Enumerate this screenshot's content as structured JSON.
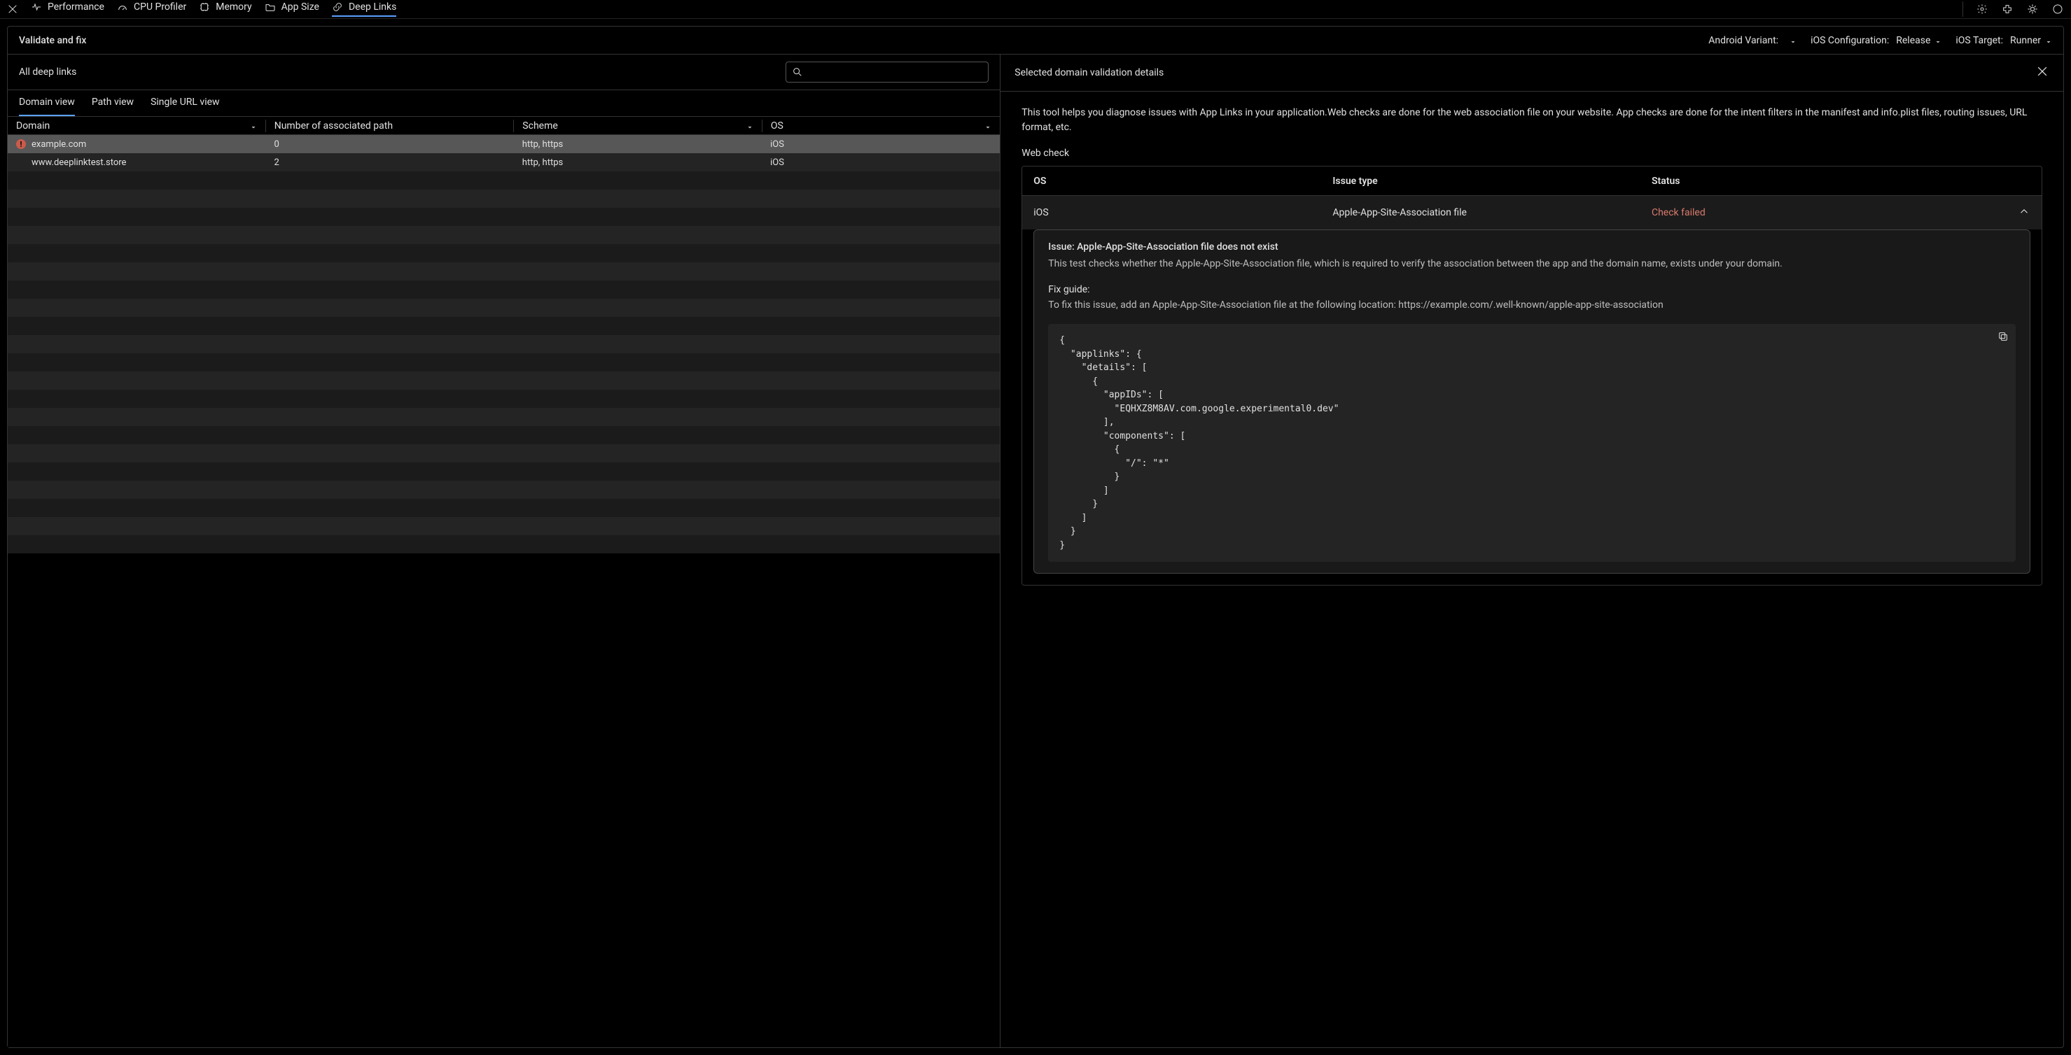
{
  "nav": {
    "tabs": [
      {
        "label": "Performance",
        "icon": "pulse-icon"
      },
      {
        "label": "CPU Profiler",
        "icon": "gauge-icon"
      },
      {
        "label": "Memory",
        "icon": "layers-icon"
      },
      {
        "label": "App Size",
        "icon": "folder-icon"
      },
      {
        "label": "Deep Links",
        "icon": "link-icon",
        "active": true
      }
    ]
  },
  "configBar": {
    "title": "Validate and fix",
    "androidVariantLabel": "Android Variant:",
    "androidVariantValue": "",
    "iosConfigLabel": "iOS Configuration:",
    "iosConfigValue": "Release",
    "iosTargetLabel": "iOS Target:",
    "iosTargetValue": "Runner"
  },
  "leftPane": {
    "header": "All deep links",
    "searchPlaceholder": "",
    "tabs": {
      "domain": "Domain view",
      "path": "Path view",
      "single": "Single URL view"
    },
    "tableHeaders": {
      "domain": "Domain",
      "paths": "Number of associated path",
      "scheme": "Scheme",
      "os": "OS"
    },
    "rows": [
      {
        "status": "error",
        "domain": "example.com",
        "paths": "0",
        "scheme": "http, https",
        "os": "iOS",
        "selected": true
      },
      {
        "status": "",
        "domain": "www.deeplinktest.store",
        "paths": "2",
        "scheme": "http, https",
        "os": "iOS",
        "selected": false
      }
    ]
  },
  "rightPane": {
    "header": "Selected domain validation details",
    "description": "This tool helps you diagnose issues with App Links in your application.Web checks are done for the web association file on your website. App checks are done for the intent filters in the manifest and info.plist files, routing issues, URL format, etc.",
    "webCheckLabel": "Web check",
    "wcHeaders": {
      "os": "OS",
      "type": "Issue type",
      "status": "Status"
    },
    "wcRow": {
      "os": "iOS",
      "type": "Apple-App-Site-Association file",
      "status": "Check failed"
    },
    "detail": {
      "issueTitle": "Issue: Apple-App-Site-Association file does not exist",
      "issueBody": "This test checks whether the Apple-App-Site-Association file, which is required to verify the association between the app and the domain name, exists under your domain.",
      "fixTitle": "Fix guide:",
      "fixBody": "To fix this issue, add an Apple-App-Site-Association file at the following location: https://example.com/.well-known/apple-app-site-association",
      "code": "{\n  \"applinks\": {\n    \"details\": [\n      {\n        \"appIDs\": [\n          \"EQHXZ8M8AV.com.google.experimental0.dev\"\n        ],\n        \"components\": [\n          {\n            \"/\": \"*\"\n          }\n        ]\n      }\n    ]\n  }\n}"
    }
  }
}
